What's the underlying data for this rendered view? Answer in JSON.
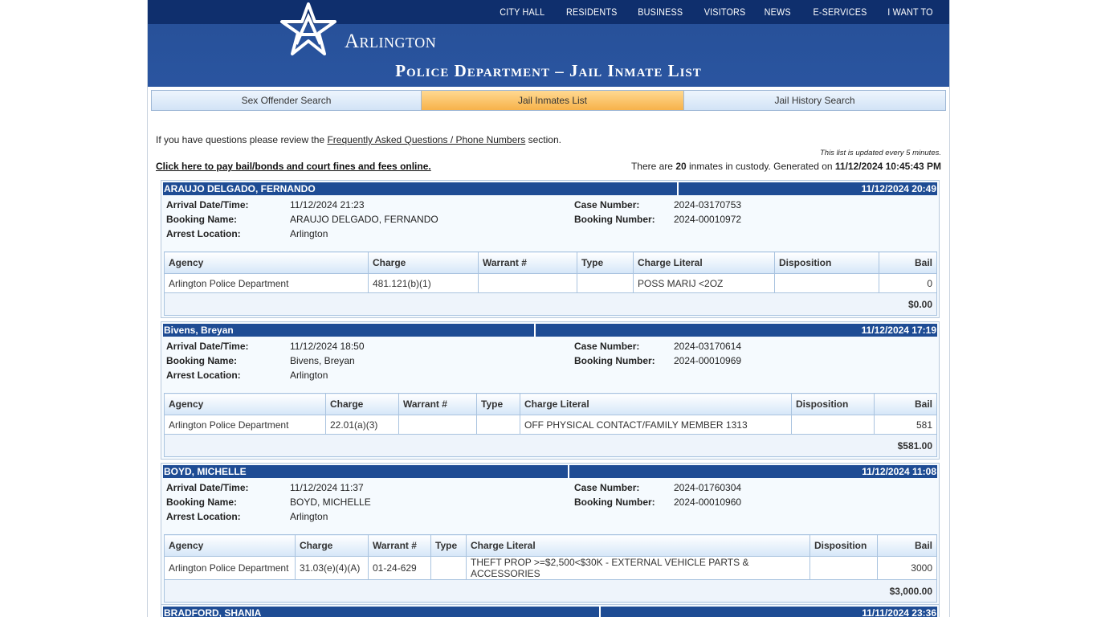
{
  "topnav": [
    "CITY HALL",
    "RESIDENTS",
    "BUSINESS",
    "VISITORS",
    "NEWS",
    "E-SERVICES",
    "I WANT TO"
  ],
  "logo": {
    "text": "Arlington"
  },
  "heading": "Police Department – Jail Inmate List",
  "tabs": [
    {
      "label": "Sex Offender Search",
      "active": false
    },
    {
      "label": "Jail Inmates List",
      "active": true
    },
    {
      "label": "Jail History Search",
      "active": false
    }
  ],
  "intro": {
    "before": "If you have questions please review the ",
    "link": "Frequently Asked Questions / Phone Numbers",
    "after": " section."
  },
  "updated_note": "This list is updated every 5 minutes.",
  "pay_link": "Click here to pay bail/bonds and court fines and fees online.",
  "count": {
    "prefix": "There are ",
    "number": "20",
    "middle": " inmates in custody. Generated on ",
    "generated": "11/12/2024 10:45:43 PM"
  },
  "labels": {
    "arrival": "Arrival Date/Time:",
    "booking_name": "Booking Name:",
    "arrest_location": "Arrest Location:",
    "case_number": "Case Number:",
    "booking_number": "Booking Number:",
    "agency": "Agency",
    "charge": "Charge",
    "warrant": "Warrant #",
    "type": "Type",
    "charge_literal": "Charge Literal",
    "disposition": "Disposition",
    "bail": "Bail"
  },
  "inmates": [
    {
      "name": "ARAUJO DELGADO, FERNANDO",
      "header_date": "11/12/2024 20:49",
      "arrival": "11/12/2024 21:23",
      "booking_name": "ARAUJO DELGADO, FERNANDO",
      "arrest_location": "Arlington",
      "case_number": "2024-03170753",
      "booking_number": "2024-00010972",
      "charges": [
        {
          "agency": "Arlington Police Department",
          "charge": "481.121(b)(1)",
          "warrant": "",
          "type": "",
          "literal": "POSS MARIJ <2OZ",
          "disposition": "",
          "bail": "0"
        }
      ],
      "total": "$0.00"
    },
    {
      "name": "Bivens, Breyan",
      "header_date": "11/12/2024 17:19",
      "arrival": "11/12/2024 18:50",
      "booking_name": "Bivens, Breyan",
      "arrest_location": "Arlington",
      "case_number": "2024-03170614",
      "booking_number": "2024-00010969",
      "charges": [
        {
          "agency": "Arlington Police Department",
          "charge": "22.01(a)(3)",
          "warrant": "",
          "type": "",
          "literal": "OFF PHYSICAL CONTACT/FAMILY MEMBER 1313",
          "disposition": "",
          "bail": "581"
        }
      ],
      "total": "$581.00"
    },
    {
      "name": "BOYD, MICHELLE",
      "header_date": "11/12/2024 11:08",
      "arrival": "11/12/2024 11:37",
      "booking_name": "BOYD, MICHELLE",
      "arrest_location": "Arlington",
      "case_number": "2024-01760304",
      "booking_number": "2024-00010960",
      "charges": [
        {
          "agency": "Arlington Police Department",
          "charge": "31.03(e)(4)(A)",
          "warrant": "01-24-629",
          "type": "",
          "literal": "THEFT PROP >=$2,500<$30K - EXTERNAL VEHICLE PARTS & ACCESSORIES",
          "disposition": "",
          "bail": "3000"
        }
      ],
      "total": "$3,000.00"
    },
    {
      "name": "BRADFORD, SHANIA",
      "header_date": "11/11/2024 23:36"
    }
  ],
  "colors": {
    "header_bg": "#264f97",
    "topnav_bg": "#0f2f6d",
    "record_head": "#1e4c94",
    "active_tab": "#f7b24a"
  }
}
